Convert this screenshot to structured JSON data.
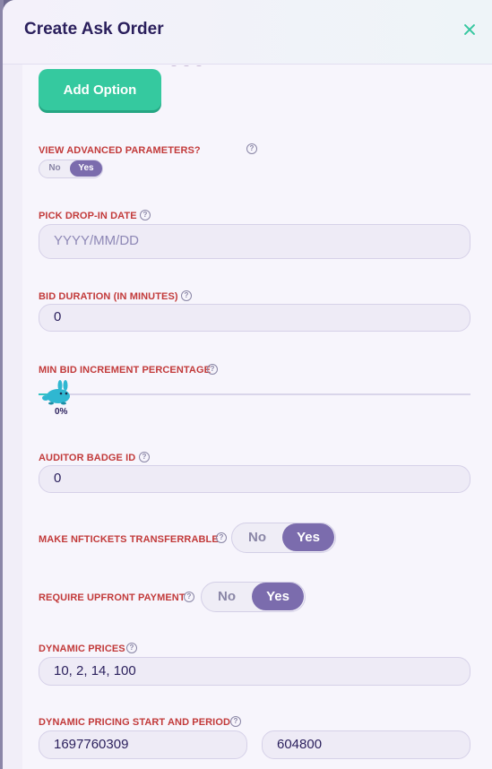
{
  "header": {
    "title": "Create Ask Order",
    "close_icon": "close-icon"
  },
  "add_option": {
    "label": "Add Option"
  },
  "advanced": {
    "label": "VIEW ADVANCED PARAMETERS?",
    "toggle": {
      "no": "No",
      "yes": "Yes",
      "selected": "Yes"
    }
  },
  "drop_in_date": {
    "label": "PICK DROP-IN DATE",
    "placeholder": "YYYY/MM/DD",
    "value": ""
  },
  "bid_duration": {
    "label": "BID DURATION (IN MINUTES)",
    "value": "0"
  },
  "min_bid_increment": {
    "label": "MIN BID INCREMENT PERCENTAGE",
    "value": "0%",
    "fraction": 0
  },
  "auditor_badge": {
    "label": "AUDITOR BADGE ID",
    "value": "0"
  },
  "transferrable": {
    "label": "MAKE NFTICKETS TRANSFERRABLE",
    "toggle": {
      "no": "No",
      "yes": "Yes",
      "selected": "Yes"
    }
  },
  "upfront_payment": {
    "label": "REQUIRE UPFRONT PAYMENT",
    "toggle": {
      "no": "No",
      "yes": "Yes",
      "selected": "Yes"
    }
  },
  "dynamic_prices": {
    "label": "DYNAMIC PRICES",
    "value": "10, 2, 14, 100"
  },
  "dynamic_pricing_period": {
    "label": "DYNAMIC PRICING START AND PERIOD",
    "start": "1697760309",
    "period": "604800"
  },
  "colors": {
    "accent": "#35c99f",
    "toggle_on": "#7b6cad",
    "label": "#c23a3a",
    "title": "#2a1f5c"
  }
}
